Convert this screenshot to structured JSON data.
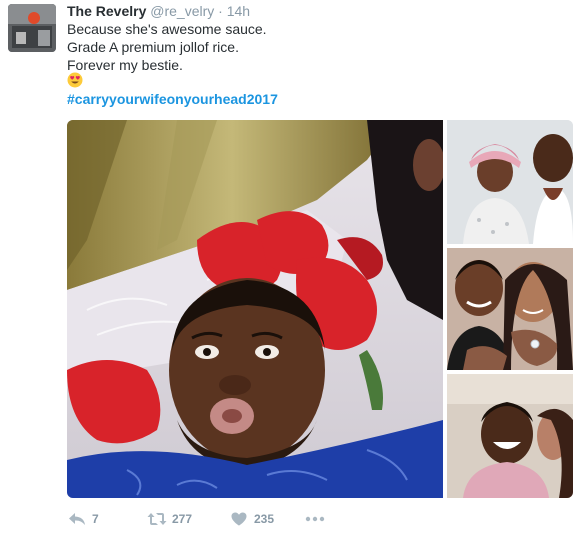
{
  "tweet": {
    "author_name": "The Revelry",
    "handle": "@re_velry",
    "separator": "·",
    "time": "14h",
    "text_lines": [
      "Because she's awesome sauce.",
      "Grade A premium jollof rice.",
      "Forever my bestie."
    ],
    "emoji": "heart-eyes-emoji",
    "hashtag": "#carryyourwifeonyourhead2017"
  },
  "actions": {
    "reply_count": "7",
    "retweet_count": "277",
    "like_count": "235"
  },
  "colors": {
    "link": "#1b95e0",
    "muted": "#8899a6",
    "text": "#292f33"
  },
  "icons": {
    "reply": "reply-icon",
    "retweet": "retweet-icon",
    "like": "heart-icon",
    "more": "more-icon"
  }
}
